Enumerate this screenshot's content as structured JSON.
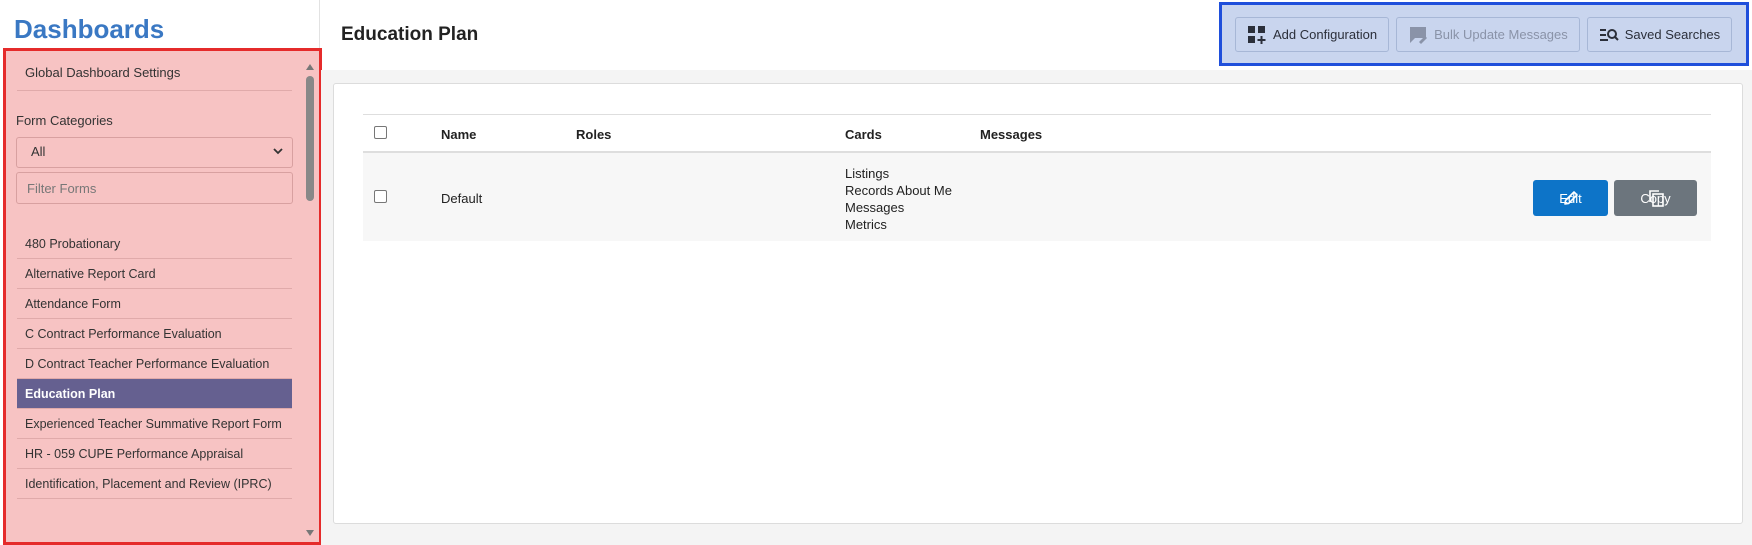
{
  "app": {
    "title": "Dashboards"
  },
  "sidebar": {
    "global_link": "Global Dashboard Settings",
    "categories_label": "Form Categories",
    "category_selected": "All",
    "filter_placeholder": "Filter Forms",
    "forms": [
      "480 Probationary",
      "Alternative Report Card",
      "Attendance Form",
      "C Contract Performance Evaluation",
      "D Contract Teacher Performance Evaluation",
      "Education Plan",
      "Experienced Teacher Summative Report Form",
      "HR - 059 CUPE Performance Appraisal",
      "Identification, Placement and Review (IPRC)"
    ],
    "active_form": "Education Plan"
  },
  "header": {
    "title": "Education Plan",
    "buttons": {
      "add_configuration": "Add Configuration",
      "bulk_update_messages": "Bulk Update Messages",
      "saved_searches": "Saved Searches"
    }
  },
  "table": {
    "columns": {
      "name": "Name",
      "roles": "Roles",
      "cards": "Cards",
      "messages": "Messages"
    },
    "rows": [
      {
        "name": "Default",
        "roles": "",
        "cards": [
          "Listings",
          "Records About Me",
          "Messages",
          "Metrics"
        ],
        "messages": "",
        "edit_label": "Edit",
        "copy_label": "Copy"
      }
    ]
  },
  "colors": {
    "title_blue": "#3a78c3",
    "active_item": "#656090",
    "edit_button": "#0d74c8",
    "copy_button": "#6c757d"
  }
}
